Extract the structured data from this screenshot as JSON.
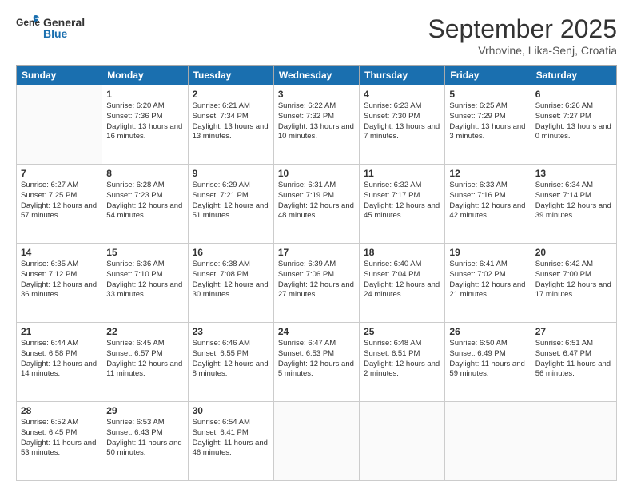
{
  "header": {
    "logo_general": "General",
    "logo_blue": "Blue",
    "month_title": "September 2025",
    "location": "Vrhovine, Lika-Senj, Croatia"
  },
  "days_of_week": [
    "Sunday",
    "Monday",
    "Tuesday",
    "Wednesday",
    "Thursday",
    "Friday",
    "Saturday"
  ],
  "weeks": [
    [
      {
        "day": null,
        "sunrise": null,
        "sunset": null,
        "daylight": null
      },
      {
        "day": "1",
        "sunrise": "Sunrise: 6:20 AM",
        "sunset": "Sunset: 7:36 PM",
        "daylight": "Daylight: 13 hours and 16 minutes."
      },
      {
        "day": "2",
        "sunrise": "Sunrise: 6:21 AM",
        "sunset": "Sunset: 7:34 PM",
        "daylight": "Daylight: 13 hours and 13 minutes."
      },
      {
        "day": "3",
        "sunrise": "Sunrise: 6:22 AM",
        "sunset": "Sunset: 7:32 PM",
        "daylight": "Daylight: 13 hours and 10 minutes."
      },
      {
        "day": "4",
        "sunrise": "Sunrise: 6:23 AM",
        "sunset": "Sunset: 7:30 PM",
        "daylight": "Daylight: 13 hours and 7 minutes."
      },
      {
        "day": "5",
        "sunrise": "Sunrise: 6:25 AM",
        "sunset": "Sunset: 7:29 PM",
        "daylight": "Daylight: 13 hours and 3 minutes."
      },
      {
        "day": "6",
        "sunrise": "Sunrise: 6:26 AM",
        "sunset": "Sunset: 7:27 PM",
        "daylight": "Daylight: 13 hours and 0 minutes."
      }
    ],
    [
      {
        "day": "7",
        "sunrise": "Sunrise: 6:27 AM",
        "sunset": "Sunset: 7:25 PM",
        "daylight": "Daylight: 12 hours and 57 minutes."
      },
      {
        "day": "8",
        "sunrise": "Sunrise: 6:28 AM",
        "sunset": "Sunset: 7:23 PM",
        "daylight": "Daylight: 12 hours and 54 minutes."
      },
      {
        "day": "9",
        "sunrise": "Sunrise: 6:29 AM",
        "sunset": "Sunset: 7:21 PM",
        "daylight": "Daylight: 12 hours and 51 minutes."
      },
      {
        "day": "10",
        "sunrise": "Sunrise: 6:31 AM",
        "sunset": "Sunset: 7:19 PM",
        "daylight": "Daylight: 12 hours and 48 minutes."
      },
      {
        "day": "11",
        "sunrise": "Sunrise: 6:32 AM",
        "sunset": "Sunset: 7:17 PM",
        "daylight": "Daylight: 12 hours and 45 minutes."
      },
      {
        "day": "12",
        "sunrise": "Sunrise: 6:33 AM",
        "sunset": "Sunset: 7:16 PM",
        "daylight": "Daylight: 12 hours and 42 minutes."
      },
      {
        "day": "13",
        "sunrise": "Sunrise: 6:34 AM",
        "sunset": "Sunset: 7:14 PM",
        "daylight": "Daylight: 12 hours and 39 minutes."
      }
    ],
    [
      {
        "day": "14",
        "sunrise": "Sunrise: 6:35 AM",
        "sunset": "Sunset: 7:12 PM",
        "daylight": "Daylight: 12 hours and 36 minutes."
      },
      {
        "day": "15",
        "sunrise": "Sunrise: 6:36 AM",
        "sunset": "Sunset: 7:10 PM",
        "daylight": "Daylight: 12 hours and 33 minutes."
      },
      {
        "day": "16",
        "sunrise": "Sunrise: 6:38 AM",
        "sunset": "Sunset: 7:08 PM",
        "daylight": "Daylight: 12 hours and 30 minutes."
      },
      {
        "day": "17",
        "sunrise": "Sunrise: 6:39 AM",
        "sunset": "Sunset: 7:06 PM",
        "daylight": "Daylight: 12 hours and 27 minutes."
      },
      {
        "day": "18",
        "sunrise": "Sunrise: 6:40 AM",
        "sunset": "Sunset: 7:04 PM",
        "daylight": "Daylight: 12 hours and 24 minutes."
      },
      {
        "day": "19",
        "sunrise": "Sunrise: 6:41 AM",
        "sunset": "Sunset: 7:02 PM",
        "daylight": "Daylight: 12 hours and 21 minutes."
      },
      {
        "day": "20",
        "sunrise": "Sunrise: 6:42 AM",
        "sunset": "Sunset: 7:00 PM",
        "daylight": "Daylight: 12 hours and 17 minutes."
      }
    ],
    [
      {
        "day": "21",
        "sunrise": "Sunrise: 6:44 AM",
        "sunset": "Sunset: 6:58 PM",
        "daylight": "Daylight: 12 hours and 14 minutes."
      },
      {
        "day": "22",
        "sunrise": "Sunrise: 6:45 AM",
        "sunset": "Sunset: 6:57 PM",
        "daylight": "Daylight: 12 hours and 11 minutes."
      },
      {
        "day": "23",
        "sunrise": "Sunrise: 6:46 AM",
        "sunset": "Sunset: 6:55 PM",
        "daylight": "Daylight: 12 hours and 8 minutes."
      },
      {
        "day": "24",
        "sunrise": "Sunrise: 6:47 AM",
        "sunset": "Sunset: 6:53 PM",
        "daylight": "Daylight: 12 hours and 5 minutes."
      },
      {
        "day": "25",
        "sunrise": "Sunrise: 6:48 AM",
        "sunset": "Sunset: 6:51 PM",
        "daylight": "Daylight: 12 hours and 2 minutes."
      },
      {
        "day": "26",
        "sunrise": "Sunrise: 6:50 AM",
        "sunset": "Sunset: 6:49 PM",
        "daylight": "Daylight: 11 hours and 59 minutes."
      },
      {
        "day": "27",
        "sunrise": "Sunrise: 6:51 AM",
        "sunset": "Sunset: 6:47 PM",
        "daylight": "Daylight: 11 hours and 56 minutes."
      }
    ],
    [
      {
        "day": "28",
        "sunrise": "Sunrise: 6:52 AM",
        "sunset": "Sunset: 6:45 PM",
        "daylight": "Daylight: 11 hours and 53 minutes."
      },
      {
        "day": "29",
        "sunrise": "Sunrise: 6:53 AM",
        "sunset": "Sunset: 6:43 PM",
        "daylight": "Daylight: 11 hours and 50 minutes."
      },
      {
        "day": "30",
        "sunrise": "Sunrise: 6:54 AM",
        "sunset": "Sunset: 6:41 PM",
        "daylight": "Daylight: 11 hours and 46 minutes."
      },
      {
        "day": null,
        "sunrise": null,
        "sunset": null,
        "daylight": null
      },
      {
        "day": null,
        "sunrise": null,
        "sunset": null,
        "daylight": null
      },
      {
        "day": null,
        "sunrise": null,
        "sunset": null,
        "daylight": null
      },
      {
        "day": null,
        "sunrise": null,
        "sunset": null,
        "daylight": null
      }
    ]
  ]
}
